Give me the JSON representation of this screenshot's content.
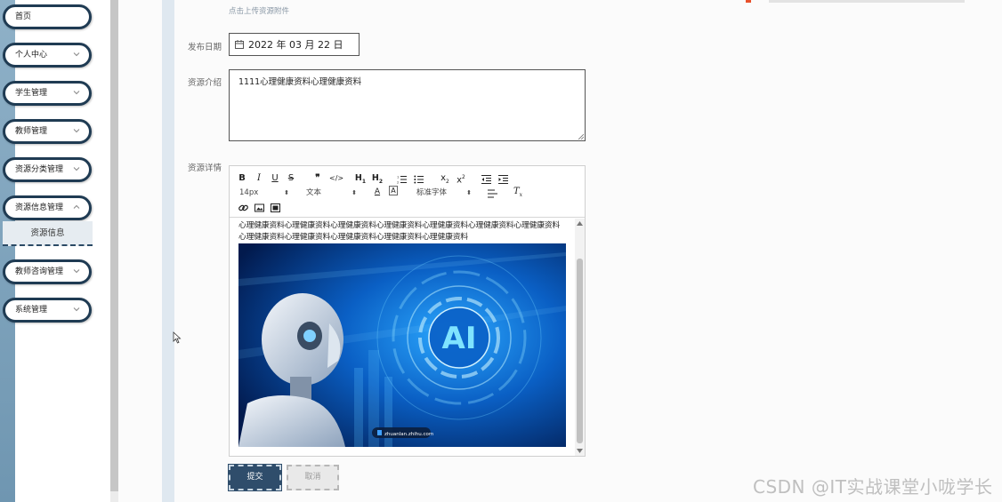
{
  "sidebar": {
    "items": [
      {
        "label": "首页",
        "has_chevron": false
      },
      {
        "label": "个人中心",
        "has_chevron": true
      },
      {
        "label": "学生管理",
        "has_chevron": true
      },
      {
        "label": "教师管理",
        "has_chevron": true
      },
      {
        "label": "资源分类管理",
        "has_chevron": true
      },
      {
        "label": "资源信息管理",
        "has_chevron": true,
        "expanded": true
      },
      {
        "label": "教师咨询管理",
        "has_chevron": true
      },
      {
        "label": "系统管理",
        "has_chevron": true
      }
    ],
    "sub_item": "资源信息"
  },
  "form": {
    "upload_hint": "点击上传资源附件",
    "date_label": "发布日期",
    "date_value": "2022 年 03 月 22 日",
    "intro_label": "资源介绍",
    "intro_value": "1111心理健康资料心理健康资料",
    "detail_label": "资源详情",
    "submit_label": "提交",
    "cancel_label": "取消"
  },
  "editor": {
    "font_size": "14px",
    "paragraph": "文本",
    "font_family": "标准字体",
    "content_line1": "心理健康资料心理健康资料心理健康资料心理健康资料心理健康资料心理健康资料心理健康资料",
    "content_line2": "心理健康资料心理健康资料心理健康资料心理健康资料心理健康资料",
    "image_badge": "zhuanlan.zhihu.com",
    "image_title": "AI"
  },
  "watermark": "CSDN @IT实战课堂小咙学长",
  "colors": {
    "nav_border": "#1f3b53",
    "submit_bg": "#2f4d6b",
    "ai_blue": "#0a5fc4"
  }
}
